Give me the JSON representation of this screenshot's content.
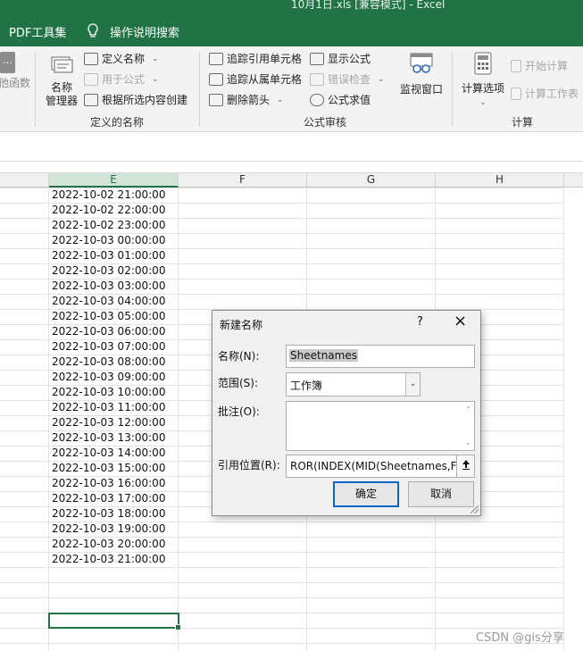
{
  "window": {
    "title": "10月1日.xls  [兼容模式]  -  Excel"
  },
  "top_tabs": {
    "pdf": "PDF工具集",
    "tellme": "操作说明搜索"
  },
  "ribbon": {
    "insert_function_fragment": "他函数",
    "defined_names": {
      "name_manager": "名称\n管理器",
      "define_name": "定义名称",
      "use_in_formula": "用于公式",
      "create_from_selection": "根据所选内容创建",
      "group_label": "定义的名称"
    },
    "formula_auditing": {
      "trace_precedents": "追踪引用单元格",
      "trace_dependents": "追踪从属单元格",
      "remove_arrows": "删除箭头",
      "show_formulas": "显示公式",
      "error_checking": "错误检查",
      "evaluate_formula": "公式求值",
      "watch_window": "监视窗口",
      "group_label": "公式审核"
    },
    "calculation": {
      "calc_options": "计算选项",
      "calc_now": "开始计算",
      "calc_sheet": "计算工作表",
      "group_label": "计算"
    }
  },
  "sheet": {
    "columns": [
      "E",
      "F",
      "G",
      "H"
    ],
    "selected_column": "E",
    "cells_E": [
      "2022-10-02 21:00:00",
      "2022-10-02 22:00:00",
      "2022-10-02 23:00:00",
      "2022-10-03 00:00:00",
      "2022-10-03 01:00:00",
      "2022-10-03 02:00:00",
      "2022-10-03 03:00:00",
      "2022-10-03 04:00:00",
      "2022-10-03 05:00:00",
      "2022-10-03 06:00:00",
      "2022-10-03 07:00:00",
      "2022-10-03 08:00:00",
      "2022-10-03 09:00:00",
      "2022-10-03 10:00:00",
      "2022-10-03 11:00:00",
      "2022-10-03 12:00:00",
      "2022-10-03 13:00:00",
      "2022-10-03 14:00:00",
      "2022-10-03 15:00:00",
      "2022-10-03 16:00:00",
      "2022-10-03 17:00:00",
      "2022-10-03 18:00:00",
      "2022-10-03 19:00:00",
      "2022-10-03 20:00:00",
      "2022-10-03 21:00:00"
    ]
  },
  "dialog": {
    "title": "新建名称",
    "help": "?",
    "close": "×",
    "name_label": "名称(N):",
    "name_value": "Sheetnames",
    "scope_label": "范围(S):",
    "scope_value": "工作簿",
    "comment_label": "批注(O):",
    "comment_value": "",
    "refers_label": "引用位置(R):",
    "refers_value": "ROR(INDEX(MID(Sheetnames,F",
    "ok": "确定",
    "cancel": "取消"
  },
  "watermark": "CSDN @gis分享",
  "colors": {
    "excel_green": "#217346",
    "ribbon_bg": "#f3f3f3",
    "dialog_bg": "#f0f0f0",
    "focus_blue": "#0a64c8"
  }
}
